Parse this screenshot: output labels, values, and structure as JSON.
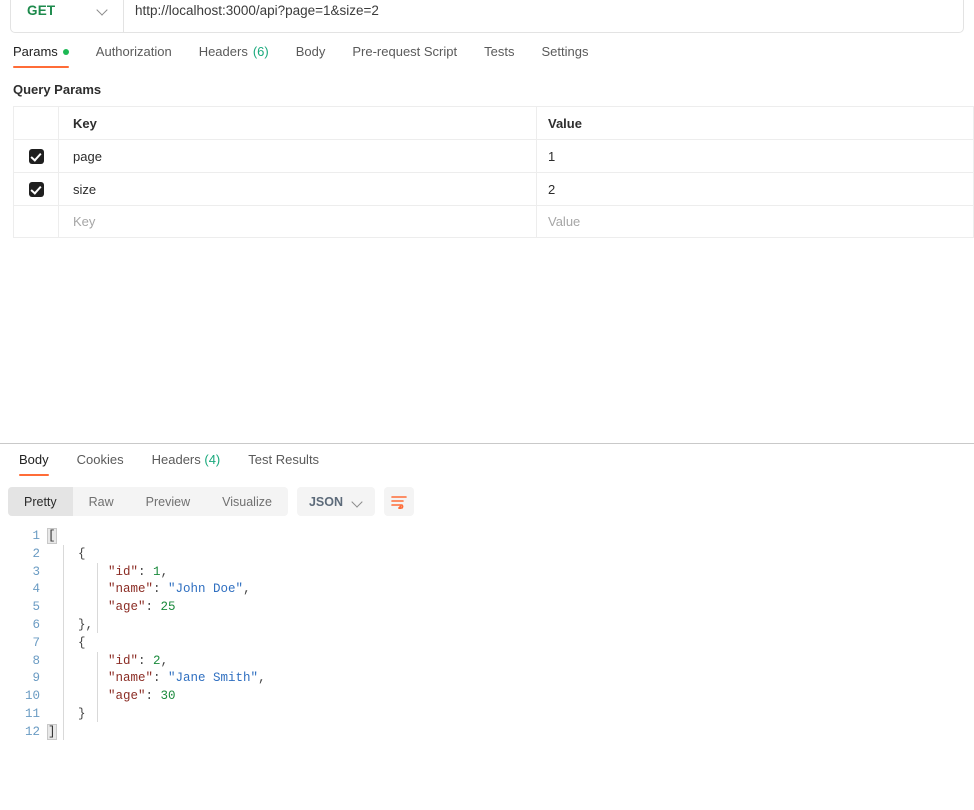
{
  "request": {
    "method": "GET",
    "method_color": "#1d8a4c",
    "url": "http://localhost:3000/api?page=1&size=2",
    "tabs": [
      {
        "label": "Params",
        "active": true,
        "dot": true
      },
      {
        "label": "Authorization",
        "active": false
      },
      {
        "label": "Headers",
        "count": "(6)",
        "active": false
      },
      {
        "label": "Body",
        "active": false
      },
      {
        "label": "Pre-request Script",
        "active": false
      },
      {
        "label": "Tests",
        "active": false
      },
      {
        "label": "Settings",
        "active": false
      }
    ]
  },
  "query_params": {
    "section_title": "Query Params",
    "columns": {
      "key": "Key",
      "value": "Value"
    },
    "rows": [
      {
        "checked": true,
        "key": "page",
        "value": "1"
      },
      {
        "checked": true,
        "key": "size",
        "value": "2"
      }
    ],
    "placeholder_row": {
      "key": "Key",
      "value": "Value"
    }
  },
  "response": {
    "tabs": [
      {
        "label": "Body",
        "active": true
      },
      {
        "label": "Cookies",
        "active": false
      },
      {
        "label": "Headers",
        "count": "(4)",
        "active": false
      },
      {
        "label": "Test Results",
        "active": false
      }
    ],
    "views": [
      {
        "label": "Pretty",
        "active": true
      },
      {
        "label": "Raw",
        "active": false
      },
      {
        "label": "Preview",
        "active": false
      },
      {
        "label": "Visualize",
        "active": false
      }
    ],
    "format": "JSON",
    "wrap_icon": "wrap-text-icon",
    "body_lines": [
      {
        "n": "1",
        "tokens": [
          {
            "t": "[",
            "c": "br-hi"
          }
        ]
      },
      {
        "n": "2",
        "tokens": [
          {
            "t": "    ",
            "c": "p"
          },
          {
            "t": "{",
            "c": "p"
          }
        ]
      },
      {
        "n": "3",
        "tokens": [
          {
            "t": "        ",
            "c": "p"
          },
          {
            "t": "\"id\"",
            "c": "k"
          },
          {
            "t": ": ",
            "c": "p"
          },
          {
            "t": "1",
            "c": "n"
          },
          {
            "t": ",",
            "c": "p"
          }
        ]
      },
      {
        "n": "4",
        "tokens": [
          {
            "t": "        ",
            "c": "p"
          },
          {
            "t": "\"name\"",
            "c": "k"
          },
          {
            "t": ": ",
            "c": "p"
          },
          {
            "t": "\"John Doe\"",
            "c": "s"
          },
          {
            "t": ",",
            "c": "p"
          }
        ]
      },
      {
        "n": "5",
        "tokens": [
          {
            "t": "        ",
            "c": "p"
          },
          {
            "t": "\"age\"",
            "c": "k"
          },
          {
            "t": ": ",
            "c": "p"
          },
          {
            "t": "25",
            "c": "n"
          }
        ]
      },
      {
        "n": "6",
        "tokens": [
          {
            "t": "    ",
            "c": "p"
          },
          {
            "t": "},",
            "c": "p"
          }
        ]
      },
      {
        "n": "7",
        "tokens": [
          {
            "t": "    ",
            "c": "p"
          },
          {
            "t": "{",
            "c": "p"
          }
        ]
      },
      {
        "n": "8",
        "tokens": [
          {
            "t": "        ",
            "c": "p"
          },
          {
            "t": "\"id\"",
            "c": "k"
          },
          {
            "t": ": ",
            "c": "p"
          },
          {
            "t": "2",
            "c": "n"
          },
          {
            "t": ",",
            "c": "p"
          }
        ]
      },
      {
        "n": "9",
        "tokens": [
          {
            "t": "        ",
            "c": "p"
          },
          {
            "t": "\"name\"",
            "c": "k"
          },
          {
            "t": ": ",
            "c": "p"
          },
          {
            "t": "\"Jane Smith\"",
            "c": "s"
          },
          {
            "t": ",",
            "c": "p"
          }
        ]
      },
      {
        "n": "10",
        "tokens": [
          {
            "t": "        ",
            "c": "p"
          },
          {
            "t": "\"age\"",
            "c": "k"
          },
          {
            "t": ": ",
            "c": "p"
          },
          {
            "t": "30",
            "c": "n"
          }
        ]
      },
      {
        "n": "11",
        "tokens": [
          {
            "t": "    ",
            "c": "p"
          },
          {
            "t": "}",
            "c": "p"
          }
        ]
      },
      {
        "n": "12",
        "tokens": [
          {
            "t": "]",
            "c": "br-hi"
          }
        ]
      }
    ],
    "parsed_body": [
      {
        "id": 1,
        "name": "John Doe",
        "age": 25
      },
      {
        "id": 2,
        "name": "Jane Smith",
        "age": 30
      }
    ]
  },
  "colors": {
    "accent": "#ff6c37",
    "method_get": "#1d8a4c",
    "count_green": "#19a97c",
    "dot_green": "#1db954",
    "json_key": "#8b2c24",
    "json_string": "#2f6fc0",
    "json_number": "#1a8a3c",
    "line_number": "#6a9bc3"
  }
}
